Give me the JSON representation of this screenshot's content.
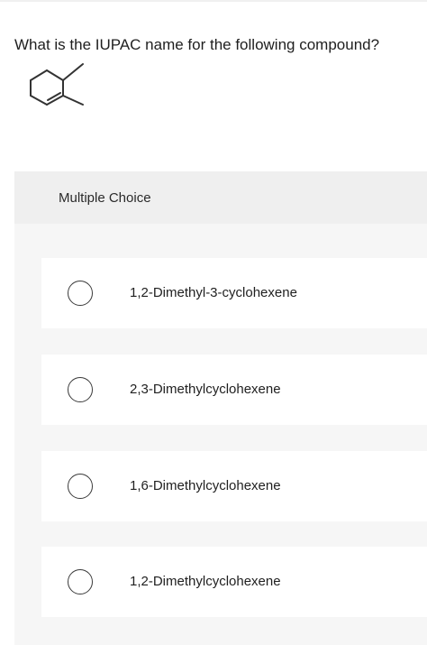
{
  "question": {
    "text": "What is the IUPAC name for the following compound?"
  },
  "structure": {
    "icon": "skeletal-structure-dimethylcyclohexene-icon"
  },
  "multiple_choice": {
    "title": "Multiple Choice",
    "options": [
      {
        "label": "1,2-Dimethyl-3-cyclohexene",
        "selected": false
      },
      {
        "label": "2,3-Dimethylcyclohexene",
        "selected": false
      },
      {
        "label": "1,6-Dimethylcyclohexene",
        "selected": false
      },
      {
        "label": "1,2-Dimethylcyclohexene",
        "selected": false
      }
    ]
  }
}
